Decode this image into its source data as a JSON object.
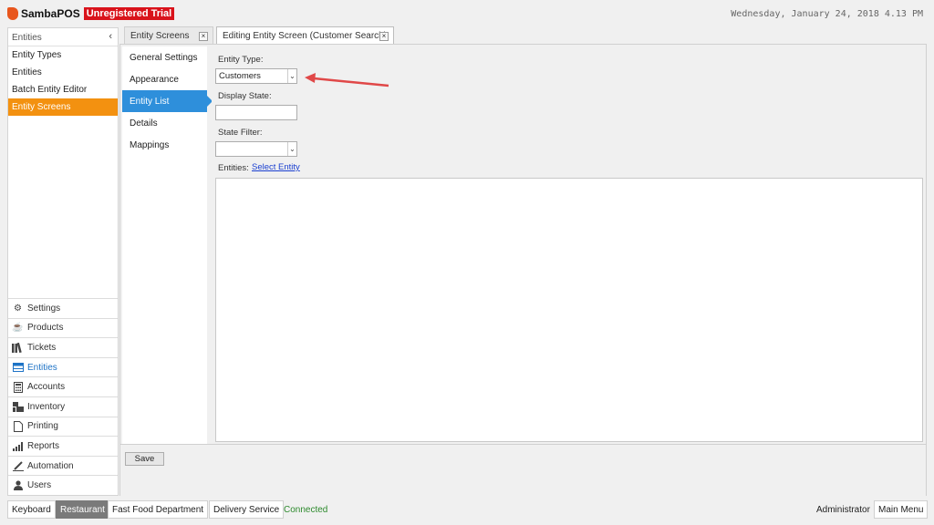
{
  "app": {
    "name": "SambaPOS",
    "trial_badge": "Unregistered Trial",
    "datetime": "Wednesday, January 24, 2018 4.13 PM"
  },
  "sidebar": {
    "header": "Entities",
    "collapse_glyph": "‹",
    "items": [
      {
        "label": "Entity Types"
      },
      {
        "label": "Entities"
      },
      {
        "label": "Batch Entity Editor"
      },
      {
        "label": "Entity Screens",
        "active": true
      }
    ],
    "modules": [
      {
        "label": "Settings",
        "icon": "gear-icon"
      },
      {
        "label": "Products",
        "icon": "coffee-icon"
      },
      {
        "label": "Tickets",
        "icon": "books-icon"
      },
      {
        "label": "Entities",
        "icon": "table-icon",
        "active": true
      },
      {
        "label": "Accounts",
        "icon": "calculator-icon"
      },
      {
        "label": "Inventory",
        "icon": "boxes-icon"
      },
      {
        "label": "Printing",
        "icon": "document-icon"
      },
      {
        "label": "Reports",
        "icon": "bar-chart-icon"
      },
      {
        "label": "Automation",
        "icon": "pen-icon"
      },
      {
        "label": "Users",
        "icon": "user-icon"
      }
    ]
  },
  "tabs": [
    {
      "label": "Entity Screens",
      "active": false
    },
    {
      "label": "Editing Entity Screen (Customer Search)",
      "active": true
    }
  ],
  "subnav": [
    {
      "label": "General Settings"
    },
    {
      "label": "Appearance"
    },
    {
      "label": "Entity List",
      "active": true
    },
    {
      "label": "Details"
    },
    {
      "label": "Mappings"
    }
  ],
  "form": {
    "entity_type_label": "Entity Type:",
    "entity_type_value": "Customers",
    "display_state_label": "Display State:",
    "display_state_value": "",
    "state_filter_label": "State Filter:",
    "state_filter_value": "",
    "entities_label": "Entities:",
    "select_entity_link": "Select Entity"
  },
  "save_label": "Save",
  "statusbar": {
    "keyboard": "Keyboard",
    "restaurant": "Restaurant",
    "department": "Fast Food Department",
    "delivery": "Delivery Service",
    "connection": "Connected",
    "user": "Administrator",
    "main_menu": "Main Menu"
  },
  "colors": {
    "accent_orange": "#f39110",
    "accent_blue": "#2e8fdb",
    "trial_red": "#d9131b",
    "annotation_arrow": "#e04848"
  }
}
